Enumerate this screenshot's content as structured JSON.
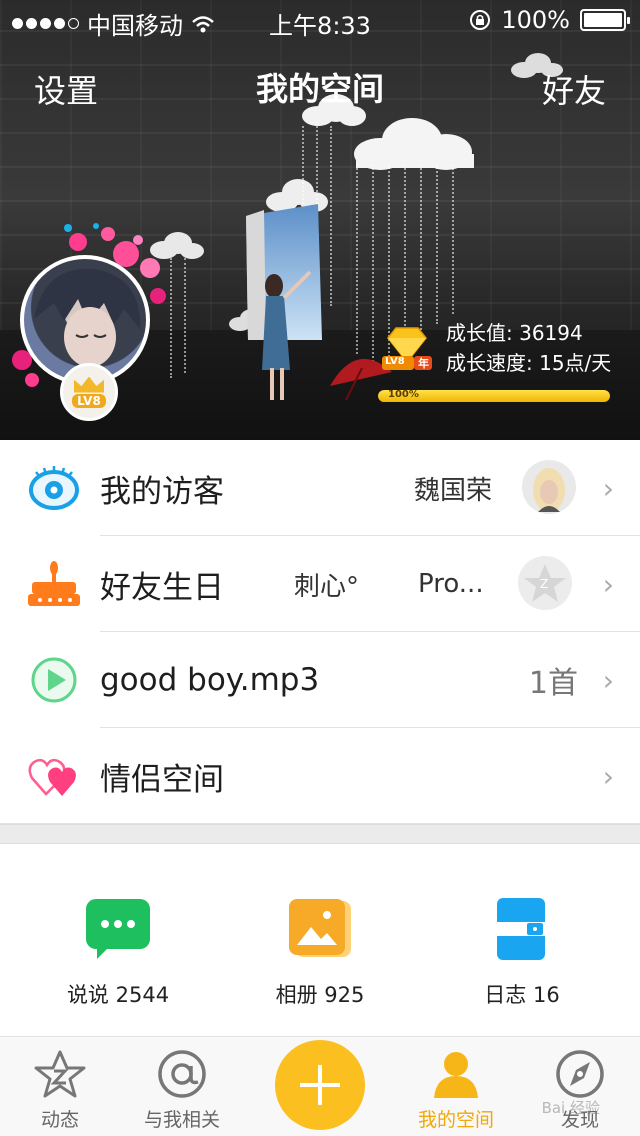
{
  "status_bar": {
    "carrier": "中国移动",
    "time": "上午8:33",
    "battery": "100%"
  },
  "nav": {
    "left": "设置",
    "title": "我的空间",
    "right": "好友"
  },
  "profile": {
    "level_badge": "LV8",
    "diamond_badge": "LV8",
    "diamond_tag": "年",
    "growth_value": "成长值: 36194",
    "growth_speed": "成长速度: 15点/天",
    "progress_label": "100%",
    "progress": 1.0
  },
  "list": {
    "visitors": {
      "label": "我的访客",
      "name": "魏国荣"
    },
    "birthday": {
      "label": "好友生日",
      "name1": "刺心°",
      "name2": "Pro..."
    },
    "music": {
      "label": "good boy.mp3",
      "count": "1首"
    },
    "couple": {
      "label": "情侣空间"
    }
  },
  "quick": [
    {
      "label": "说说 2544",
      "icon": "chat-bubble-icon",
      "color": "#1dbf5e"
    },
    {
      "label": "相册 925",
      "icon": "photo-album-icon",
      "color": "#f7a928"
    },
    {
      "label": "日志 16",
      "icon": "journal-icon",
      "color": "#1aa5f0"
    }
  ],
  "tabs": [
    {
      "label": "动态",
      "icon": "star-z-icon"
    },
    {
      "label": "与我相关",
      "icon": "at-icon"
    },
    {
      "label": "我的空间",
      "icon": "person-icon",
      "active": true
    },
    {
      "label": "发现",
      "icon": "compass-icon"
    }
  ],
  "watermark": "Bai 经验",
  "colors": {
    "accent": "#fbbf1f",
    "active_tab": "#f1a80a"
  }
}
